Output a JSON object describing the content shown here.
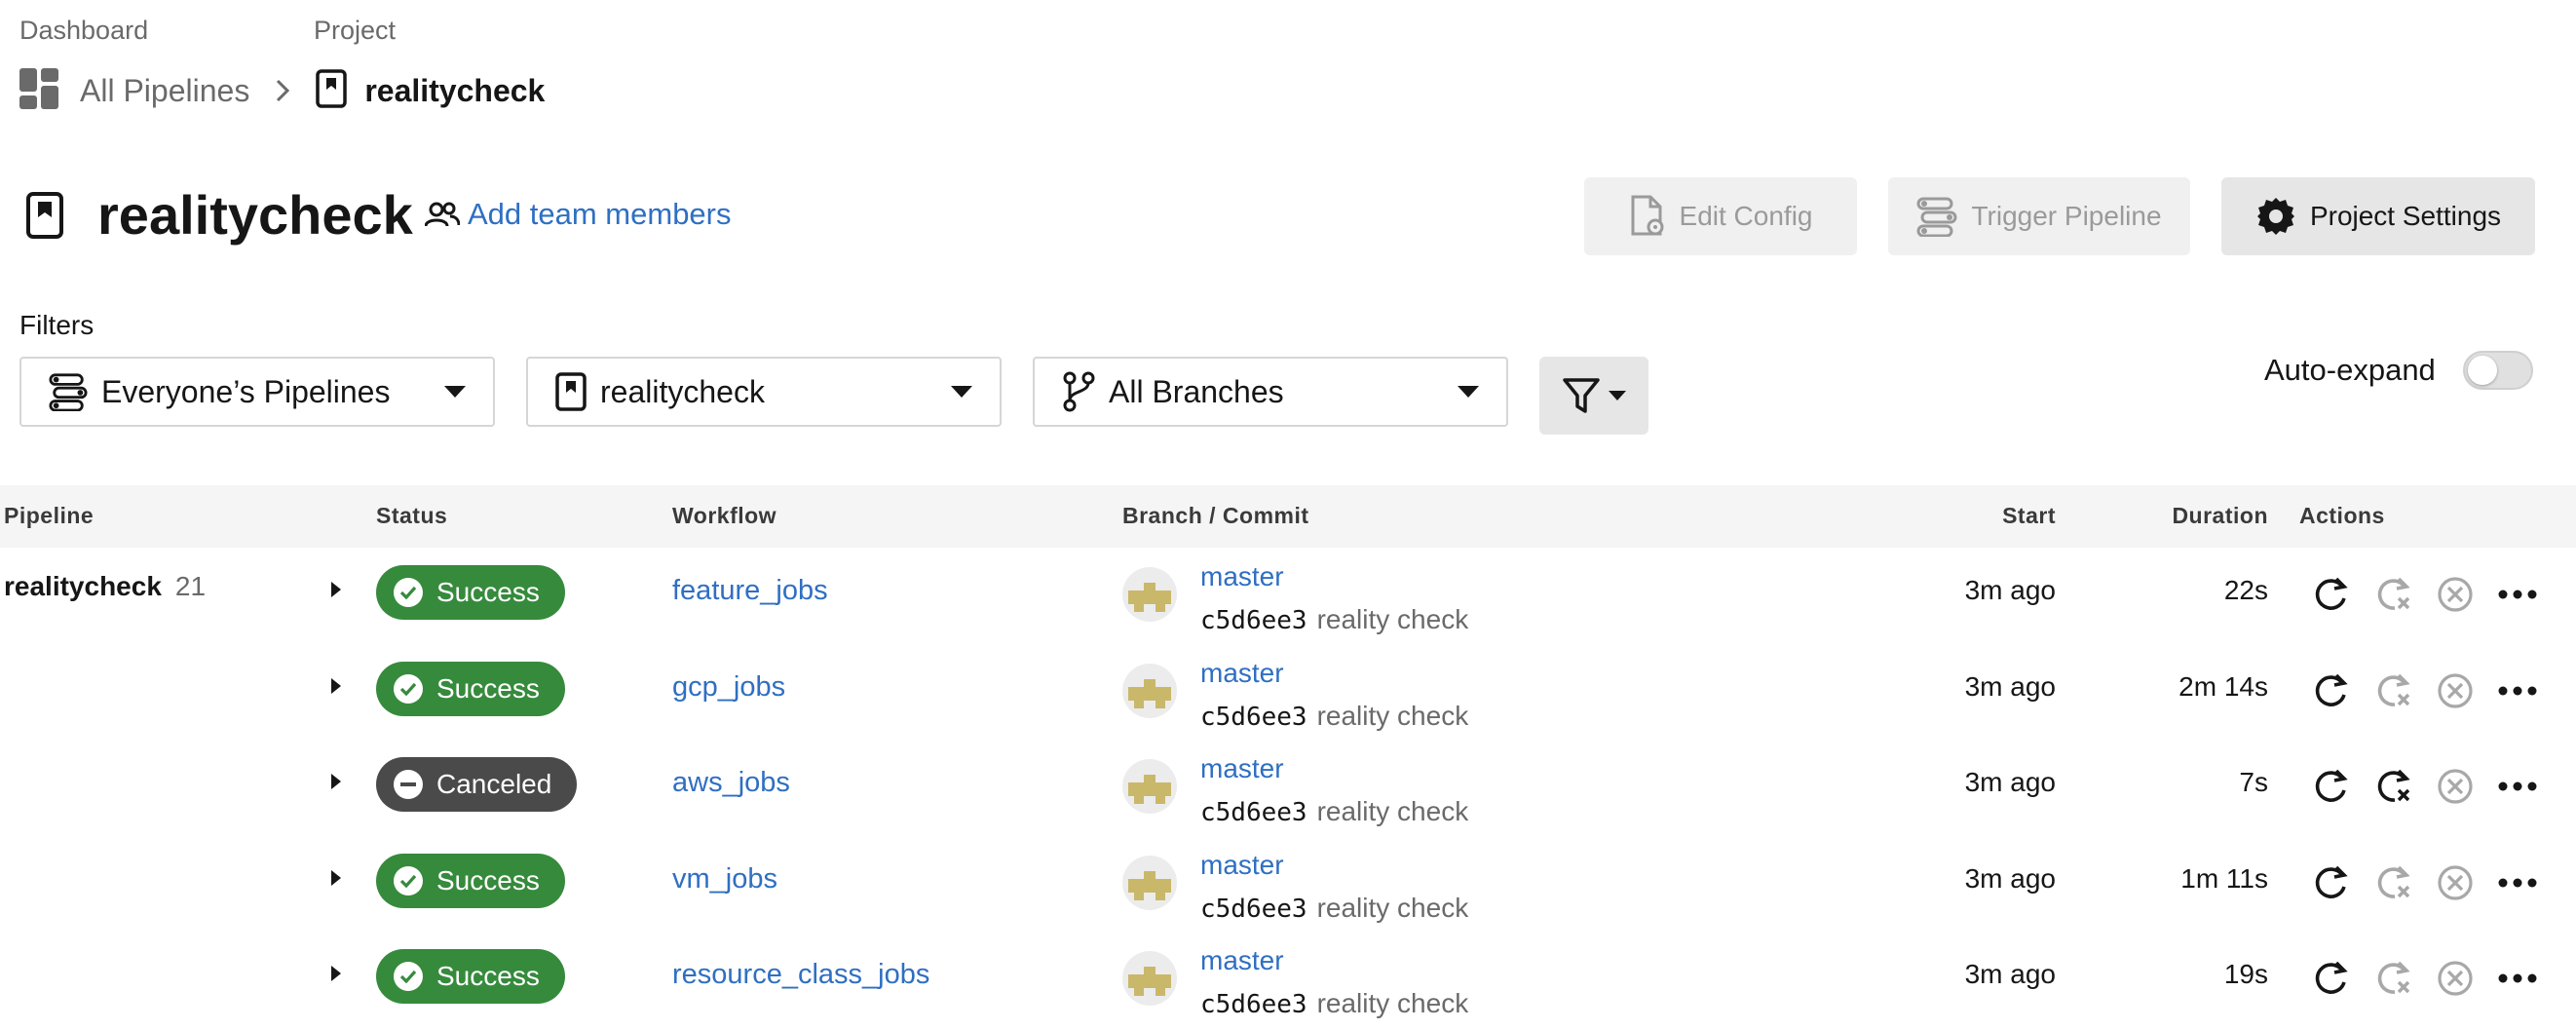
{
  "breadcrumb": {
    "dashboard_label": "Dashboard",
    "project_label": "Project",
    "all_pipelines": "All Pipelines",
    "project_name": "realitycheck"
  },
  "header": {
    "title": "realitycheck",
    "add_team": "Add team members",
    "edit_config": "Edit Config",
    "trigger_pipeline": "Trigger Pipeline",
    "project_settings": "Project Settings"
  },
  "filters": {
    "label": "Filters",
    "pipelines": "Everyone’s Pipelines",
    "project": "realitycheck",
    "branches": "All Branches",
    "auto_expand": "Auto-expand"
  },
  "table": {
    "headers": {
      "pipeline": "Pipeline",
      "status": "Status",
      "workflow": "Workflow",
      "branch_commit": "Branch / Commit",
      "start": "Start",
      "duration": "Duration",
      "actions": "Actions"
    },
    "pipeline_name": "realitycheck",
    "pipeline_number": "21",
    "rows": [
      {
        "status": "Success",
        "status_type": "success",
        "workflow": "feature_jobs",
        "branch": "master",
        "commit_hash": "c5d6ee3",
        "commit_msg": "reality check",
        "start": "3m ago",
        "duration": "22s",
        "cancel_enabled": false
      },
      {
        "status": "Success",
        "status_type": "success",
        "workflow": "gcp_jobs",
        "branch": "master",
        "commit_hash": "c5d6ee3",
        "commit_msg": "reality check",
        "start": "3m ago",
        "duration": "2m 14s",
        "cancel_enabled": false
      },
      {
        "status": "Canceled",
        "status_type": "canceled",
        "workflow": "aws_jobs",
        "branch": "master",
        "commit_hash": "c5d6ee3",
        "commit_msg": "reality check",
        "start": "3m ago",
        "duration": "7s",
        "cancel_enabled": true
      },
      {
        "status": "Success",
        "status_type": "success",
        "workflow": "vm_jobs",
        "branch": "master",
        "commit_hash": "c5d6ee3",
        "commit_msg": "reality check",
        "start": "3m ago",
        "duration": "1m 11s",
        "cancel_enabled": false
      },
      {
        "status": "Success",
        "status_type": "success",
        "workflow": "resource_class_jobs",
        "branch": "master",
        "commit_hash": "c5d6ee3",
        "commit_msg": "reality check",
        "start": "3m ago",
        "duration": "19s",
        "cancel_enabled": false
      }
    ]
  },
  "colors": {
    "link": "#2f6fc2",
    "success": "#368a3c",
    "canceled": "#4a4a4a"
  }
}
